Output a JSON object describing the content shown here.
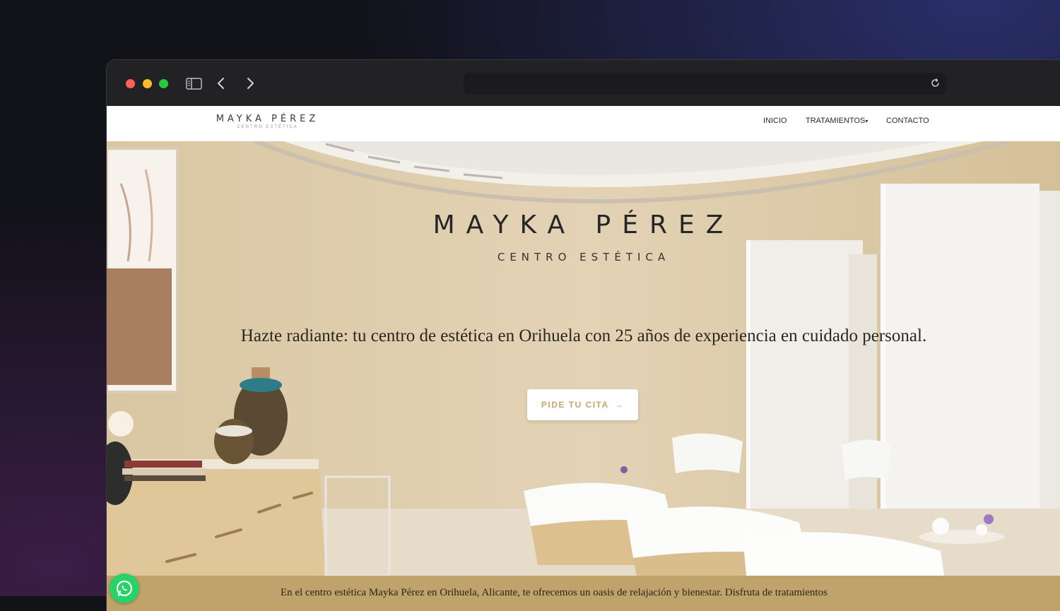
{
  "browser": {
    "url": "",
    "icons": [
      "sidebar-toggle-icon",
      "back-arrow-icon",
      "forward-arrow-icon",
      "reload-icon"
    ]
  },
  "site": {
    "logo": {
      "main": "MAYKA PÉREZ",
      "sub": "CENTRO ESTÉTICA"
    },
    "nav": {
      "inicio": "INICIO",
      "tratamientos": "TRATAMIENTOS",
      "contacto": "CONTACTO",
      "caret": "▾"
    }
  },
  "hero": {
    "title": "MAYKA PÉREZ",
    "subtitle": "CENTRO ESTÉTICA",
    "tagline": "Hazte radiante: tu centro de estética en Orihuela con 25 años de experiencia en cuidado personal.",
    "cta_label": "PIDE TU CITA",
    "cta_arrow": "→"
  },
  "footer": {
    "text": "En el centro estética Mayka Pérez en Orihuela, Alicante, te ofrecemos un oasis de relajación y bienestar. Disfruta de tratamientos"
  },
  "colors": {
    "accent_gold": "#c9a56a",
    "band_gold": "#bfa36b",
    "whatsapp_green": "#25d366"
  }
}
